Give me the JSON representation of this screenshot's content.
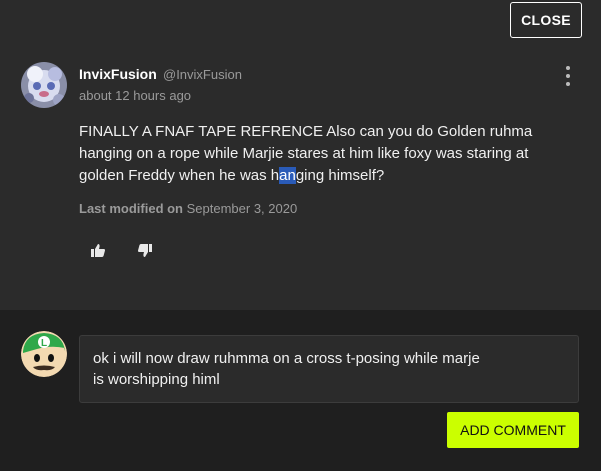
{
  "modal": {
    "close_label": "CLOSE"
  },
  "comment": {
    "author_name": "InvixFusion",
    "author_handle": "@InvixFusion",
    "timestamp": "about 12 hours ago",
    "body_before": "FINALLY A FNAF TAPE REFRENCE Also can you do Golden ruhma hanging on a rope while Marjie stares at him like foxy was staring at golden Freddy when he was h",
    "body_selected": "an",
    "body_after": "ging himself?",
    "modified_label": "Last modified on",
    "modified_date": "September 3, 2020",
    "upvote_icon": "thumbs-up-icon",
    "downvote_icon": "thumbs-down-icon"
  },
  "reply": {
    "text": "ok i will now draw ruhmma on a cross t-posing while marje\nis worshipping himl",
    "submit_label": "ADD COMMENT"
  },
  "colors": {
    "accent": "#cbff00",
    "background": "#2b2b2b",
    "selection": "#2a5bb8"
  }
}
